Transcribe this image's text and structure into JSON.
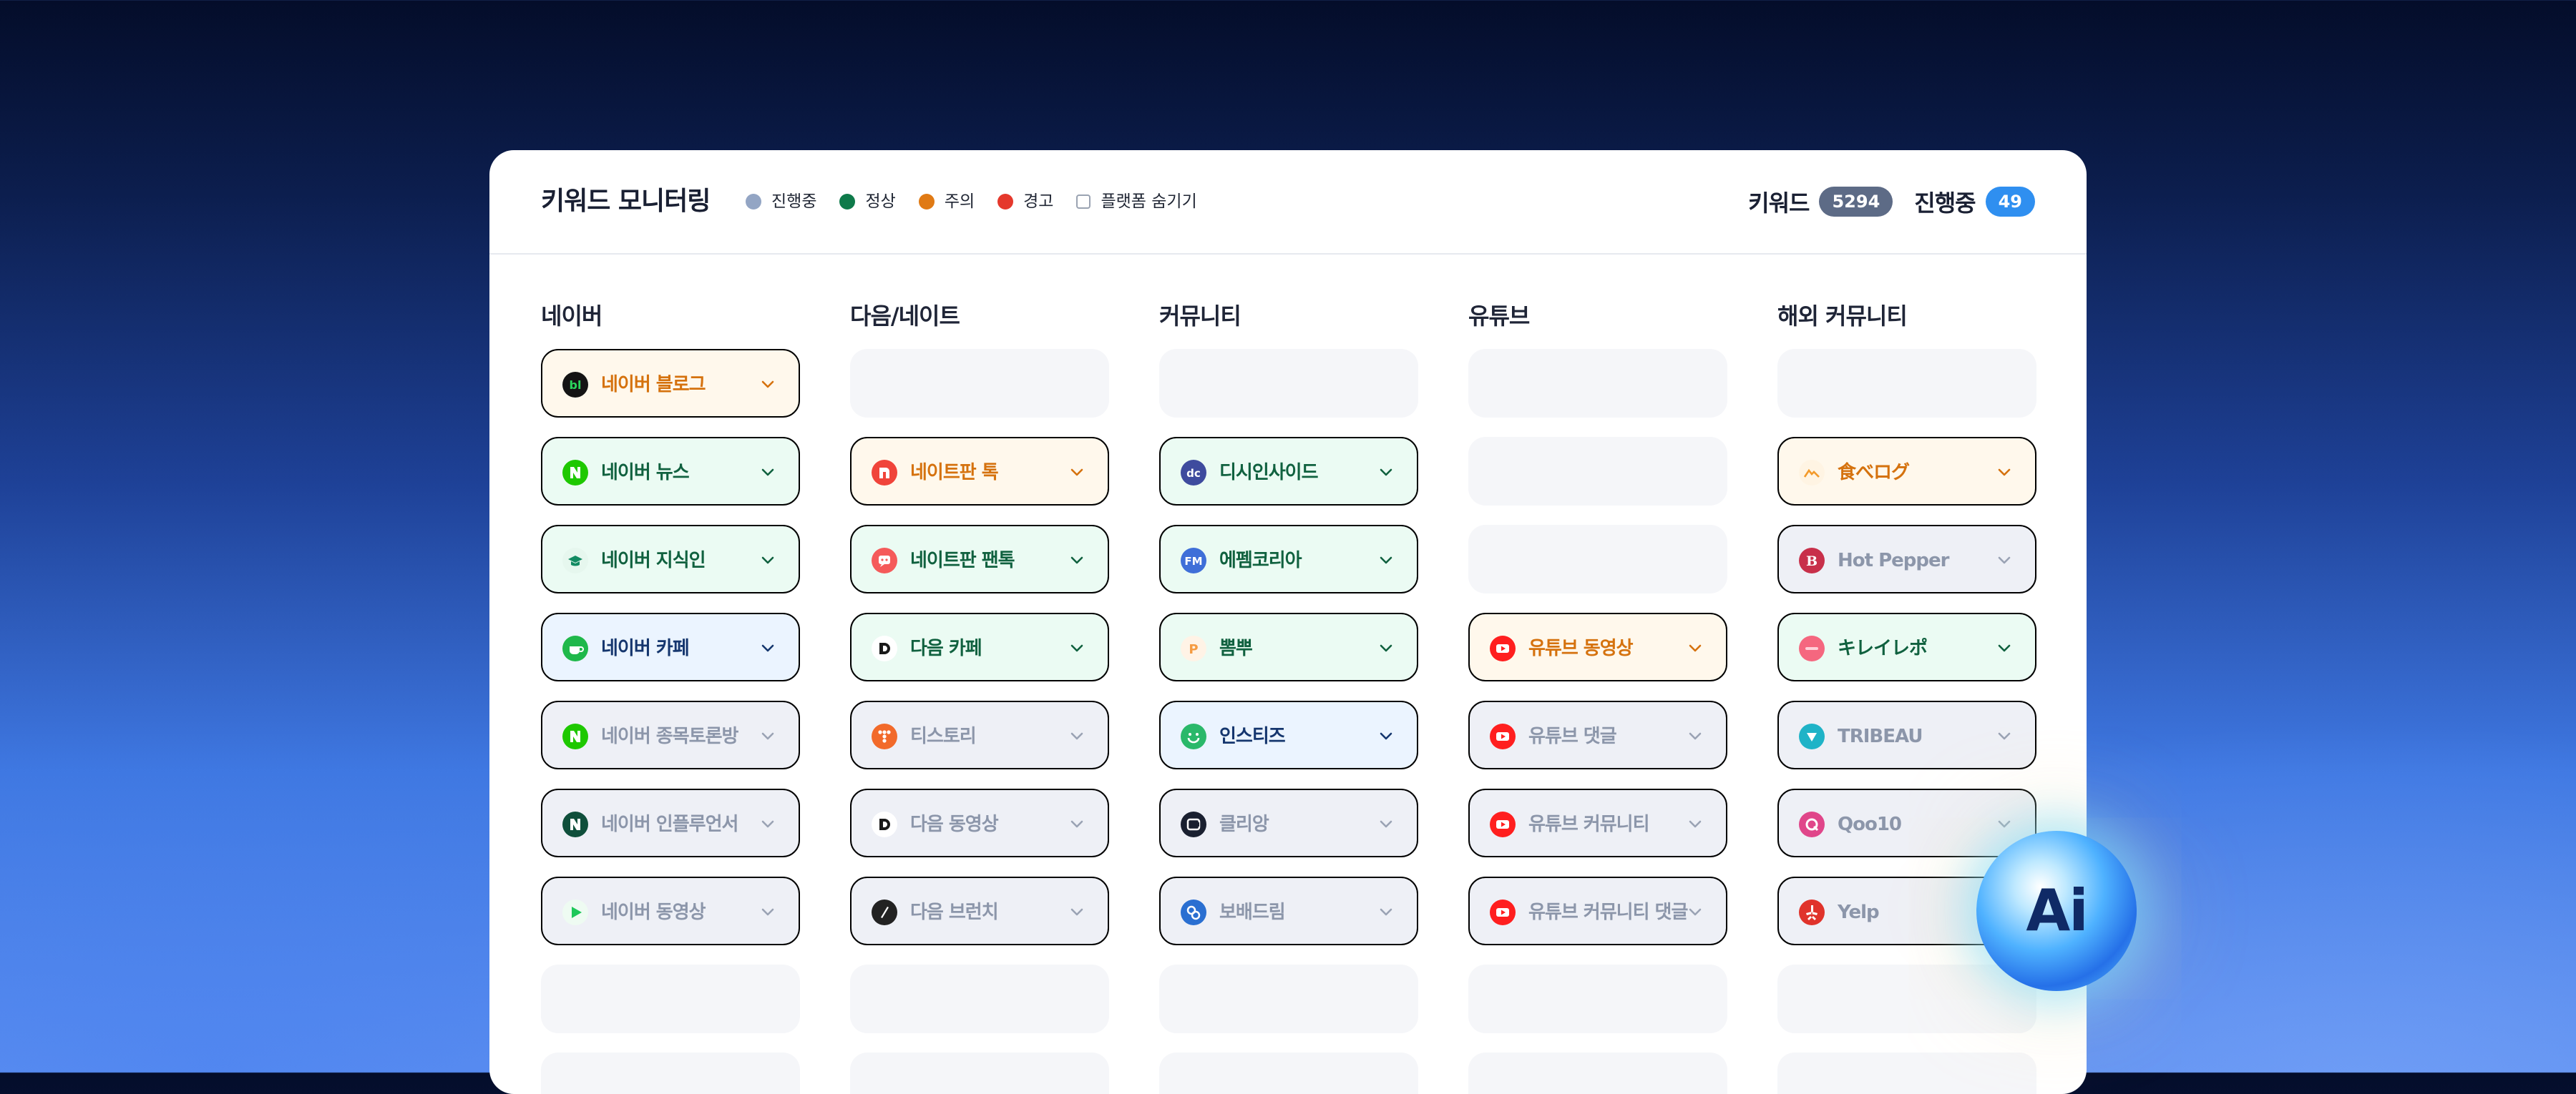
{
  "header": {
    "title": "키워드 모니터링",
    "legend": [
      {
        "label": "진행중",
        "color": "#93a5c4"
      },
      {
        "label": "정상",
        "color": "#0e7a4a"
      },
      {
        "label": "주의",
        "color": "#e07a14"
      },
      {
        "label": "경고",
        "color": "#e5382c"
      }
    ],
    "hide_platform_label": "플랫폼 숨기기",
    "keyword_label": "키워드",
    "keyword_count": "5294",
    "in_progress_label": "진행중",
    "in_progress_count": "49"
  },
  "columns": [
    {
      "title": "네이버",
      "cells": [
        {
          "label": "네이버 블로그",
          "status": "orange",
          "icon": "naver-blog-icon"
        },
        {
          "label": "네이버 뉴스",
          "status": "green",
          "icon": "naver-n-icon"
        },
        {
          "label": "네이버 지식인",
          "status": "green",
          "icon": "naver-kin-icon"
        },
        {
          "label": "네이버 카페",
          "status": "blue",
          "icon": "naver-cafe-icon"
        },
        {
          "label": "네이버 종목토론방",
          "status": "gray",
          "icon": "naver-n-icon"
        },
        {
          "label": "네이버 인플루언서",
          "status": "gray",
          "icon": "naver-influencer-icon"
        },
        {
          "label": "네이버 동영상",
          "status": "gray",
          "icon": "naver-video-icon"
        },
        null,
        null
      ]
    },
    {
      "title": "다음/네이트",
      "cells": [
        null,
        {
          "label": "네이트판 톡",
          "status": "orange",
          "icon": "nate-pann-icon"
        },
        {
          "label": "네이트판 팬톡",
          "status": "green",
          "icon": "nate-fantalk-icon"
        },
        {
          "label": "다음 카페",
          "status": "green",
          "icon": "daum-d-icon"
        },
        {
          "label": "티스토리",
          "status": "gray",
          "icon": "tistory-icon"
        },
        {
          "label": "다음 동영상",
          "status": "gray",
          "icon": "daum-d-icon"
        },
        {
          "label": "다음 브런치",
          "status": "gray",
          "icon": "brunch-icon"
        },
        null,
        null
      ]
    },
    {
      "title": "커뮤니티",
      "cells": [
        null,
        {
          "label": "디시인사이드",
          "status": "green",
          "icon": "dcinside-icon"
        },
        {
          "label": "에펨코리아",
          "status": "green",
          "icon": "fmkorea-icon"
        },
        {
          "label": "뽐뿌",
          "status": "green",
          "icon": "ppomppu-icon"
        },
        {
          "label": "인스티즈",
          "status": "blue",
          "icon": "instiz-icon"
        },
        {
          "label": "클리앙",
          "status": "gray",
          "icon": "clien-icon"
        },
        {
          "label": "보배드림",
          "status": "gray",
          "icon": "bobaedream-icon"
        },
        null,
        null
      ]
    },
    {
      "title": "유튜브",
      "cells": [
        null,
        null,
        null,
        {
          "label": "유튜브 동영상",
          "status": "orange",
          "icon": "youtube-icon"
        },
        {
          "label": "유튜브 댓글",
          "status": "gray",
          "icon": "youtube-icon"
        },
        {
          "label": "유튜브 커뮤니티",
          "status": "gray",
          "icon": "youtube-icon"
        },
        {
          "label": "유튜브 커뮤니티 댓글",
          "status": "gray",
          "icon": "youtube-icon"
        },
        null,
        null
      ]
    },
    {
      "title": "해외 커뮤니티",
      "cells": [
        null,
        {
          "label": "食べログ",
          "status": "orange",
          "icon": "tabelog-icon"
        },
        {
          "label": "Hot Pepper",
          "status": "gray",
          "icon": "hotpepper-icon"
        },
        {
          "label": "キレイレポ",
          "status": "green",
          "icon": "kireirepo-icon"
        },
        {
          "label": "TRIBEAU",
          "status": "gray",
          "icon": "tribeau-icon"
        },
        {
          "label": "Qoo10",
          "status": "gray",
          "icon": "qoo10-icon"
        },
        {
          "label": "Yelp",
          "status": "gray",
          "icon": "yelp-icon"
        },
        null,
        null
      ]
    }
  ],
  "ai_button_label": "Ai",
  "colors": {
    "badge_keyword": "#5d6b86",
    "badge_progress": "#2f8ff0"
  }
}
